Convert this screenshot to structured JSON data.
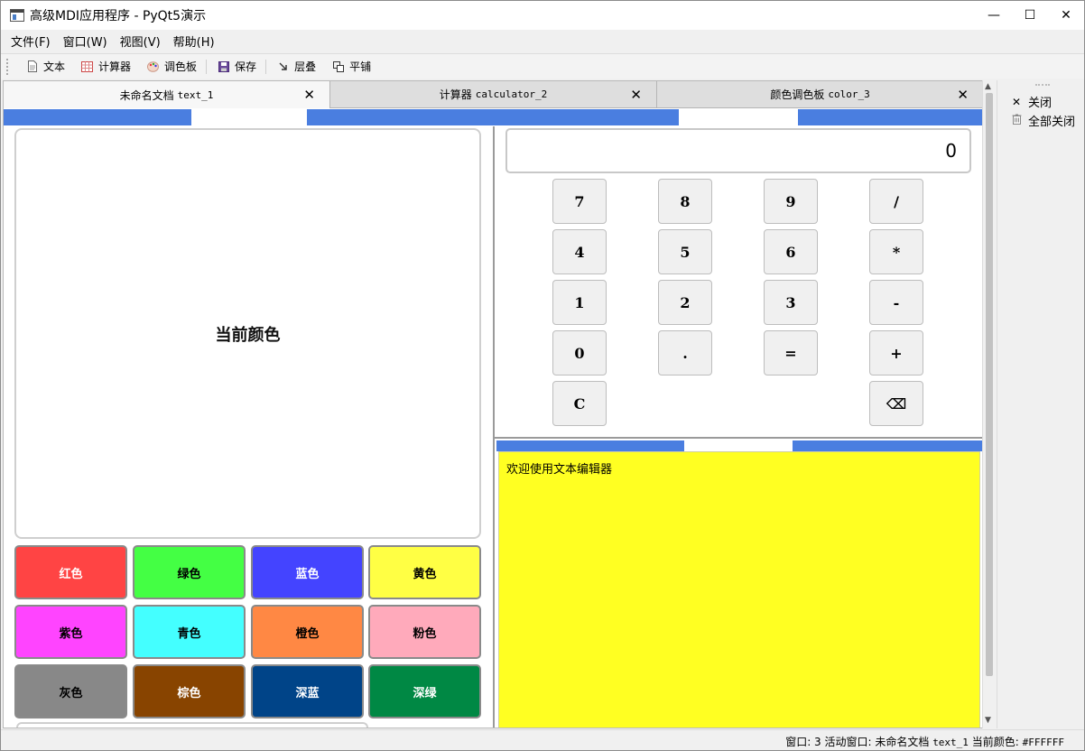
{
  "window": {
    "title": "高级MDI应用程序 - PyQt5演示",
    "controls": {
      "minimize": "—",
      "maximize": "☐",
      "close": "✕"
    }
  },
  "menubar": {
    "items": [
      "文件(F)",
      "窗口(W)",
      "视图(V)",
      "帮助(H)"
    ]
  },
  "toolbar": {
    "buttons": [
      {
        "label": "文本",
        "icon": "document-icon"
      },
      {
        "label": "计算器",
        "icon": "calculator-icon"
      },
      {
        "label": "调色板",
        "icon": "palette-icon"
      },
      {
        "label": "保存",
        "icon": "save-icon"
      },
      {
        "label": "层叠",
        "icon": "cascade-icon"
      },
      {
        "label": "平铺",
        "icon": "tile-icon"
      }
    ]
  },
  "tabs": [
    {
      "title": "未命名文档",
      "id": "text_1",
      "active": true
    },
    {
      "title": "计算器",
      "id": "calculator_2",
      "active": false
    },
    {
      "title": "颜色调色板",
      "id": "color_3",
      "active": false
    }
  ],
  "color_panel": {
    "preview_label": "当前颜色",
    "preview_color": "#FFFFFF",
    "swatches": [
      {
        "label": "红色",
        "color": "#FF4444",
        "text": "#ffffff"
      },
      {
        "label": "绿色",
        "color": "#44FF44",
        "text": "#000000"
      },
      {
        "label": "蓝色",
        "color": "#4444FF",
        "text": "#ffffff"
      },
      {
        "label": "黄色",
        "color": "#FFFF44",
        "text": "#000000"
      },
      {
        "label": "紫色",
        "color": "#FF44FF",
        "text": "#000000"
      },
      {
        "label": "青色",
        "color": "#44FFFF",
        "text": "#000000"
      },
      {
        "label": "橙色",
        "color": "#FF8844",
        "text": "#000000"
      },
      {
        "label": "粉色",
        "color": "#FFAABB",
        "text": "#000000"
      },
      {
        "label": "灰色",
        "color": "#888888",
        "text": "#000000"
      },
      {
        "label": "棕色",
        "color": "#884400",
        "text": "#ffffff"
      },
      {
        "label": "深蓝",
        "color": "#004488",
        "text": "#ffffff"
      },
      {
        "label": "深绿",
        "color": "#008844",
        "text": "#ffffff"
      }
    ]
  },
  "calculator": {
    "display": "0",
    "keys": [
      [
        "7",
        "8",
        "9",
        "/"
      ],
      [
        "4",
        "5",
        "6",
        "*"
      ],
      [
        "1",
        "2",
        "3",
        "-"
      ],
      [
        "0",
        ".",
        "=",
        "+"
      ],
      [
        "C",
        "",
        "",
        "⌫"
      ]
    ]
  },
  "editor": {
    "text": "欢迎使用文本编辑器",
    "background": "#FFFF22"
  },
  "dock": {
    "close_label": "关闭",
    "close_all_label": "全部关闭"
  },
  "status": {
    "window_count_prefix": "窗口: 3 活动窗口: 未命名文档",
    "active_id": "text_1",
    "color_prefix": "当前颜色:",
    "color_value": "#FFFFFF"
  },
  "colors": {
    "accent_stripe": "#4a7ee0"
  }
}
